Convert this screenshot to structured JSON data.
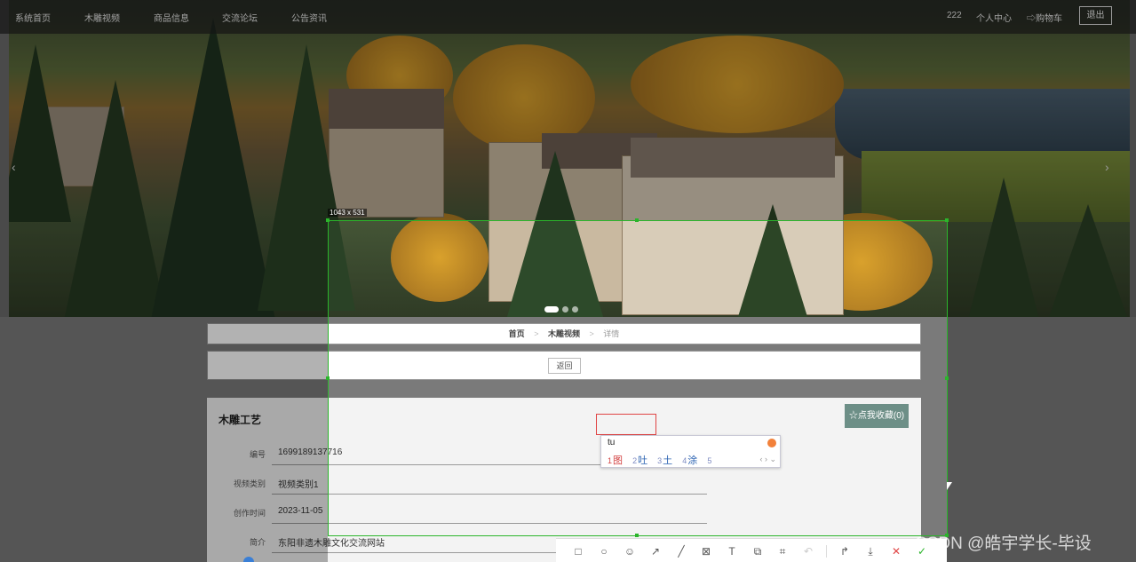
{
  "nav": {
    "items": [
      "系统首页",
      "木雕视频",
      "商品信息",
      "交流论坛",
      "公告资讯"
    ],
    "user": "222",
    "profile": "个人中心",
    "cart": "⇨购物车",
    "logout": "退出"
  },
  "hero": {
    "prev_arrow": "‹",
    "next_arrow": "›"
  },
  "breadcrumb": {
    "home": "首页",
    "section": "木雕视频",
    "current": "详情",
    "separator": ">"
  },
  "back_label": "返回",
  "detail": {
    "title": "木雕工艺",
    "favorite_label": "☆点我收藏(0)",
    "fields": [
      {
        "label": "编号",
        "value": "1699189137716"
      },
      {
        "label": "视频类别",
        "value": "视频类别1"
      },
      {
        "label": "创作时间",
        "value": "2023-11-05"
      },
      {
        "label": "简介",
        "value": "东阳非遗木雕文化交流网站"
      }
    ]
  },
  "capture": {
    "size_label": "1043 x 531",
    "accent_color": "#2bb52b"
  },
  "ime": {
    "input": "tu",
    "candidates": [
      {
        "num": "1",
        "text": "图"
      },
      {
        "num": "2",
        "text": "吐"
      },
      {
        "num": "3",
        "text": "土"
      },
      {
        "num": "4",
        "text": "涂"
      },
      {
        "num": "5",
        "text": ""
      }
    ],
    "nav": "‹ › ⌄"
  },
  "toolbar": {
    "tools": [
      {
        "name": "rectangle-tool-icon",
        "glyph": "□"
      },
      {
        "name": "ellipse-tool-icon",
        "glyph": "○"
      },
      {
        "name": "emoji-tool-icon",
        "glyph": "☺"
      },
      {
        "name": "arrow-tool-icon",
        "glyph": "↗"
      },
      {
        "name": "line-tool-icon",
        "glyph": "╱"
      },
      {
        "name": "mosaic-tool-icon",
        "glyph": "⊠"
      },
      {
        "name": "text-tool-icon",
        "glyph": "T"
      },
      {
        "name": "pin-tool-icon",
        "glyph": "⧉"
      },
      {
        "name": "ocr-tool-icon",
        "glyph": "⌗"
      },
      {
        "name": "undo-icon",
        "glyph": "↶"
      },
      {
        "name": "share-icon",
        "glyph": "↱"
      },
      {
        "name": "download-icon",
        "glyph": "⤓"
      },
      {
        "name": "cancel-icon",
        "glyph": "✕"
      },
      {
        "name": "confirm-icon",
        "glyph": "✓"
      }
    ]
  },
  "watermark": "CSDN @皓宇学长-毕设"
}
